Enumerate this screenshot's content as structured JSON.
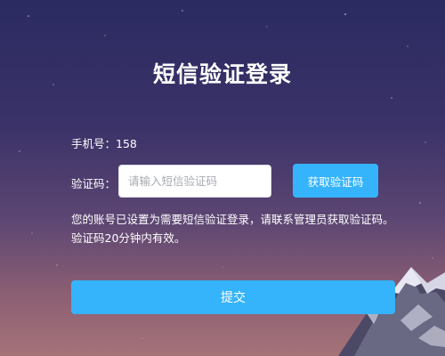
{
  "title": "短信验证登录",
  "phone": {
    "label": "手机号：",
    "value": "158"
  },
  "code": {
    "label": "验证码：",
    "placeholder": "请输入短信验证码",
    "value": ""
  },
  "get_code_button": {
    "label": "获取验证码"
  },
  "notice": "您的账号已设置为需要短信验证登录，请联系管理员获取验证码。验证码20分钟内有效。",
  "submit_button": {
    "label": "提交"
  },
  "colors": {
    "primary": "#36b4fb",
    "background_top": "#2b2b61",
    "background_bottom": "#a57278"
  }
}
